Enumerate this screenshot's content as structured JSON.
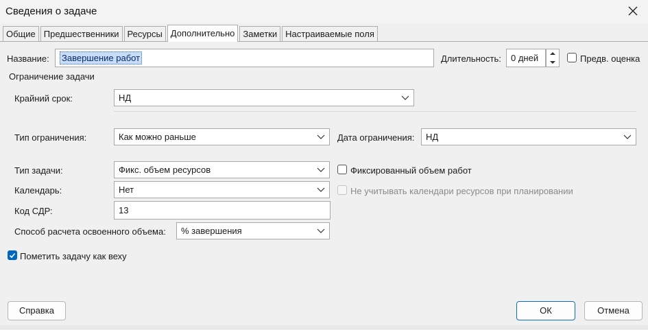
{
  "window": {
    "title": "Сведения о задаче"
  },
  "tabs": [
    {
      "label": "Общие"
    },
    {
      "label": "Предшественники"
    },
    {
      "label": "Ресурсы"
    },
    {
      "label": "Дополнительно"
    },
    {
      "label": "Заметки"
    },
    {
      "label": "Настраиваемые поля"
    }
  ],
  "active_tab": "Дополнительно",
  "name_field": {
    "label": "Название:",
    "value": "Завершение работ"
  },
  "duration": {
    "label": "Длительность:",
    "value": "0 дней"
  },
  "estimated": {
    "label": "Предв. оценка",
    "checked": false
  },
  "constraint_group": {
    "title": "Ограничение задачи",
    "deadline_label": "Крайний срок:",
    "deadline_value": "НД",
    "constraint_type_label": "Тип ограничения:",
    "constraint_type_value": "Как можно раньше",
    "constraint_date_label": "Дата ограничения:",
    "constraint_date_value": "НД"
  },
  "task_type": {
    "label": "Тип задачи:",
    "value": "Фикс. объем ресурсов"
  },
  "effort_driven": {
    "label": "Фиксированный объем работ",
    "checked": false
  },
  "calendar": {
    "label": "Календарь:",
    "value": "Нет"
  },
  "ignore_resource_calendars": {
    "label": "Не учитывать календари ресурсов при планировании",
    "checked": false,
    "enabled": false
  },
  "wbs": {
    "label": "Код СДР:",
    "value": "13"
  },
  "earned_value": {
    "label": "Способ расчета освоенного объема:",
    "value": "% завершения"
  },
  "milestone": {
    "label": "Пометить задачу как веху",
    "checked": true
  },
  "buttons": {
    "help": "Справка",
    "ok": "ОК",
    "cancel": "Отмена"
  },
  "colors": {
    "accent": "#0067c0",
    "selection": "#c7dcf7",
    "dialog_bg": "#f0f0f0"
  }
}
